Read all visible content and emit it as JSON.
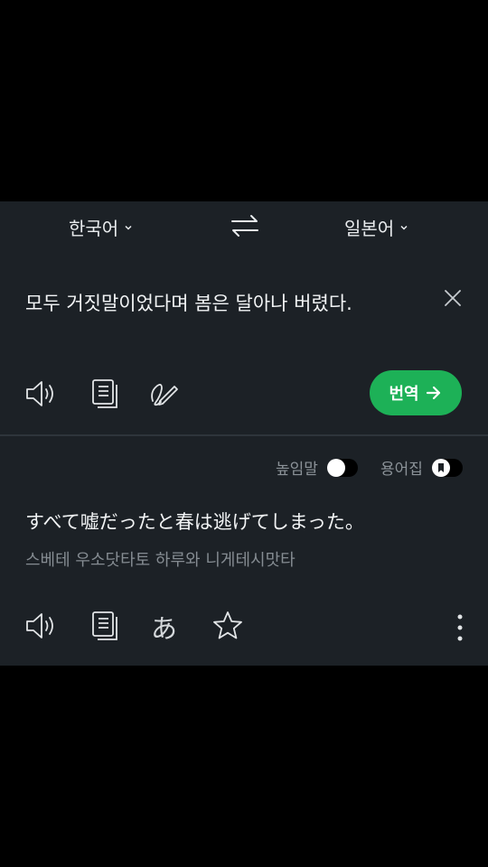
{
  "languages": {
    "source": "한국어",
    "target": "일본어"
  },
  "input": {
    "text": "모두 거짓말이었다며 봄은 달아나 버렸다."
  },
  "actions": {
    "translate_label": "번역"
  },
  "options": {
    "honorific_label": "높임말",
    "honorific_on": false,
    "glossary_label": "용어집",
    "glossary_on": false
  },
  "output": {
    "text": "すべて嘘だったと春は逃げてしまった。",
    "pronunciation": "스베테 우소닷타토 하루와 니게테시맛타",
    "hiragana_glyph": "あ"
  },
  "icons": {
    "source_toolbar": [
      "speaker-icon",
      "copy-icon",
      "handwriting-icon"
    ],
    "target_toolbar": [
      "speaker-icon",
      "copy-icon",
      "hiragana-icon",
      "star-icon",
      "more-icon"
    ]
  },
  "colors": {
    "panel_bg": "#1c2126",
    "accent_green": "#1db157",
    "text_muted": "#858c92"
  }
}
